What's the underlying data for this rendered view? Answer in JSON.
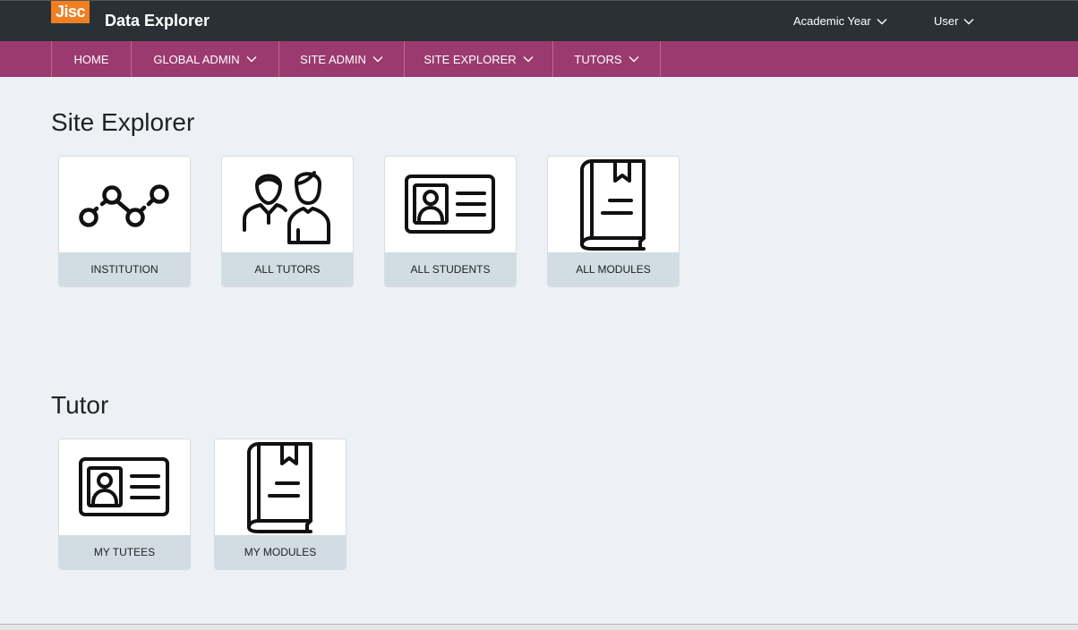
{
  "header": {
    "logo_text": "Jisc",
    "app_title": "Data Explorer",
    "academic_year_label": "Academic Year",
    "user_label": "User"
  },
  "nav": {
    "items": [
      {
        "label": "HOME"
      },
      {
        "label": "GLOBAL ADMIN"
      },
      {
        "label": "SITE ADMIN"
      },
      {
        "label": "SITE EXPLORER"
      },
      {
        "label": "TUTORS"
      }
    ]
  },
  "site_explorer": {
    "title": "Site Explorer",
    "tiles": [
      {
        "label": "INSTITUTION",
        "icon": "line-chart-icon"
      },
      {
        "label": "ALL TUTORS",
        "icon": "people-icon"
      },
      {
        "label": "ALL STUDENTS",
        "icon": "id-card-icon"
      },
      {
        "label": "ALL MODULES",
        "icon": "book-icon"
      }
    ]
  },
  "tutor": {
    "title": "Tutor",
    "tiles": [
      {
        "label": "MY TUTEES",
        "icon": "id-card-icon"
      },
      {
        "label": "MY MODULES",
        "icon": "book-icon"
      }
    ]
  },
  "colors": {
    "topbar": "#2a3136",
    "navbar": "#9b3a6f",
    "logo": "#f07f22",
    "background": "#edf1f5",
    "tile_label_bg": "#d1dde3"
  }
}
